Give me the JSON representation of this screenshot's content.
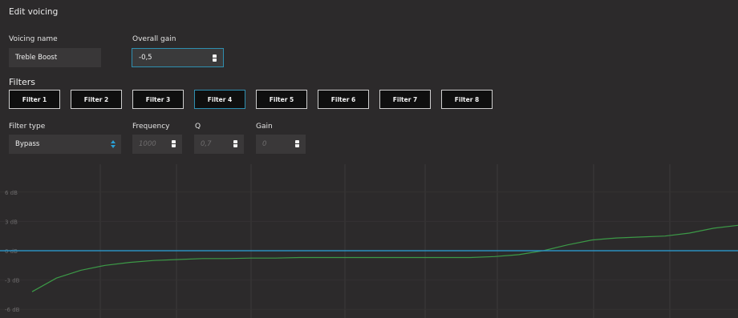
{
  "header": {
    "title": "Edit voicing"
  },
  "voicing": {
    "name_label": "Voicing name",
    "name_value": "Treble Boost",
    "gain_label": "Overall gain",
    "gain_value": "-0,5"
  },
  "filters": {
    "section_label": "Filters",
    "tabs": [
      "Filter 1",
      "Filter 2",
      "Filter 3",
      "Filter 4",
      "Filter 5",
      "Filter 6",
      "Filter 7",
      "Filter 8"
    ],
    "active_tab": "Filter 4",
    "type_label": "Filter type",
    "type_value": "Bypass",
    "frequency_label": "Frequency",
    "frequency_value": "1000",
    "q_label": "Q",
    "q_value": "0,7",
    "gain_label": "Gain",
    "gain_value": "0"
  },
  "colors": {
    "background": "#2c2a2b",
    "accent": "#2f8fb0",
    "curve": "#3c9a47",
    "flat_line": "#2b8fc0"
  },
  "chart_data": {
    "type": "line",
    "ylabel": "",
    "yticks": [
      "6 dB",
      "3 dB",
      "0 dB",
      "-3 dB",
      "-6 dB"
    ],
    "ylim": [
      -6,
      6
    ],
    "grid": true,
    "series": [
      {
        "values": [
          -4.2,
          -2.8,
          -2.0,
          -1.5,
          -1.2,
          -1.0,
          -0.9,
          -0.8,
          -0.8,
          -0.75,
          -0.75,
          -0.7,
          -0.7,
          -0.7,
          -0.7,
          -0.7,
          -0.7,
          -0.7,
          -0.7,
          -0.6,
          -0.4,
          0.0,
          0.6,
          1.1,
          1.3,
          1.4,
          1.5,
          1.8,
          2.3,
          2.6
        ]
      },
      {
        "values": [
          0,
          0,
          0,
          0,
          0,
          0,
          0,
          0,
          0,
          0,
          0,
          0,
          0,
          0,
          0,
          0,
          0,
          0,
          0,
          0,
          0,
          0,
          0,
          0,
          0,
          0,
          0,
          0,
          0,
          0
        ]
      }
    ]
  }
}
